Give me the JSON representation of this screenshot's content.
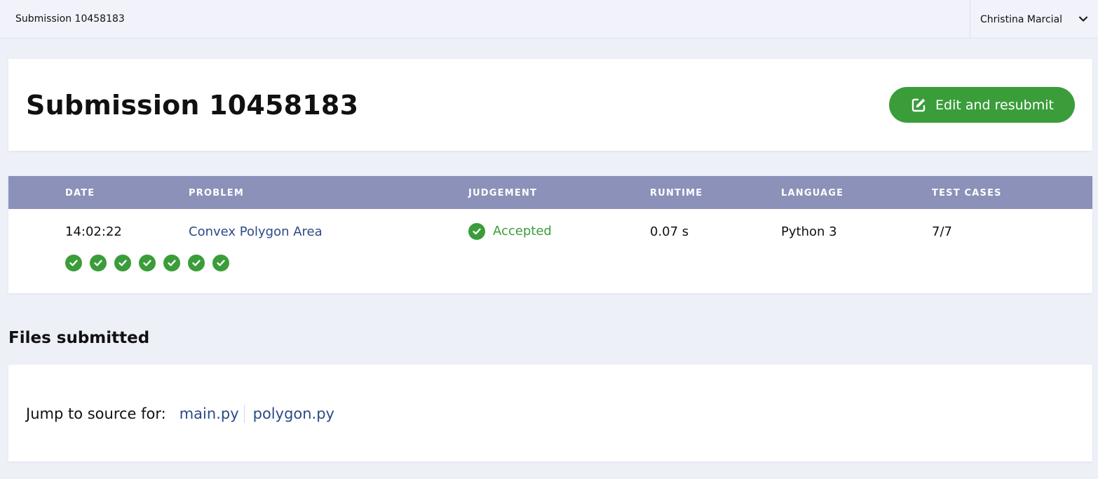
{
  "topbar": {
    "breadcrumb": "Submission 10458183",
    "user_name": "Christina Marcial"
  },
  "header": {
    "title": "Submission 10458183",
    "resubmit_label": "Edit and resubmit"
  },
  "table": {
    "columns": [
      "DATE",
      "PROBLEM",
      "JUDGEMENT",
      "RUNTIME",
      "LANGUAGE",
      "TEST CASES"
    ],
    "row": {
      "date": "14:02:22",
      "problem": "Convex Polygon Area",
      "judgement": "Accepted",
      "runtime": "0.07 s",
      "language": "Python 3",
      "test_cases": "7/7"
    },
    "test_results": [
      "passed",
      "passed",
      "passed",
      "passed",
      "passed",
      "passed",
      "passed"
    ]
  },
  "files": {
    "heading": "Files submitted",
    "jump_label": "Jump to source for:",
    "file_links": [
      "main.py",
      "polygon.py"
    ]
  },
  "colors": {
    "accent_green": "#3a9d3a",
    "table_header": "#8b91b8",
    "link": "#2d4a87",
    "background": "#eef0f8"
  },
  "icons": {
    "resubmit": "edit-icon",
    "user_menu": "chevron-down-icon",
    "judgement": "check-circle-icon",
    "test_case": "check-circle-icon"
  }
}
